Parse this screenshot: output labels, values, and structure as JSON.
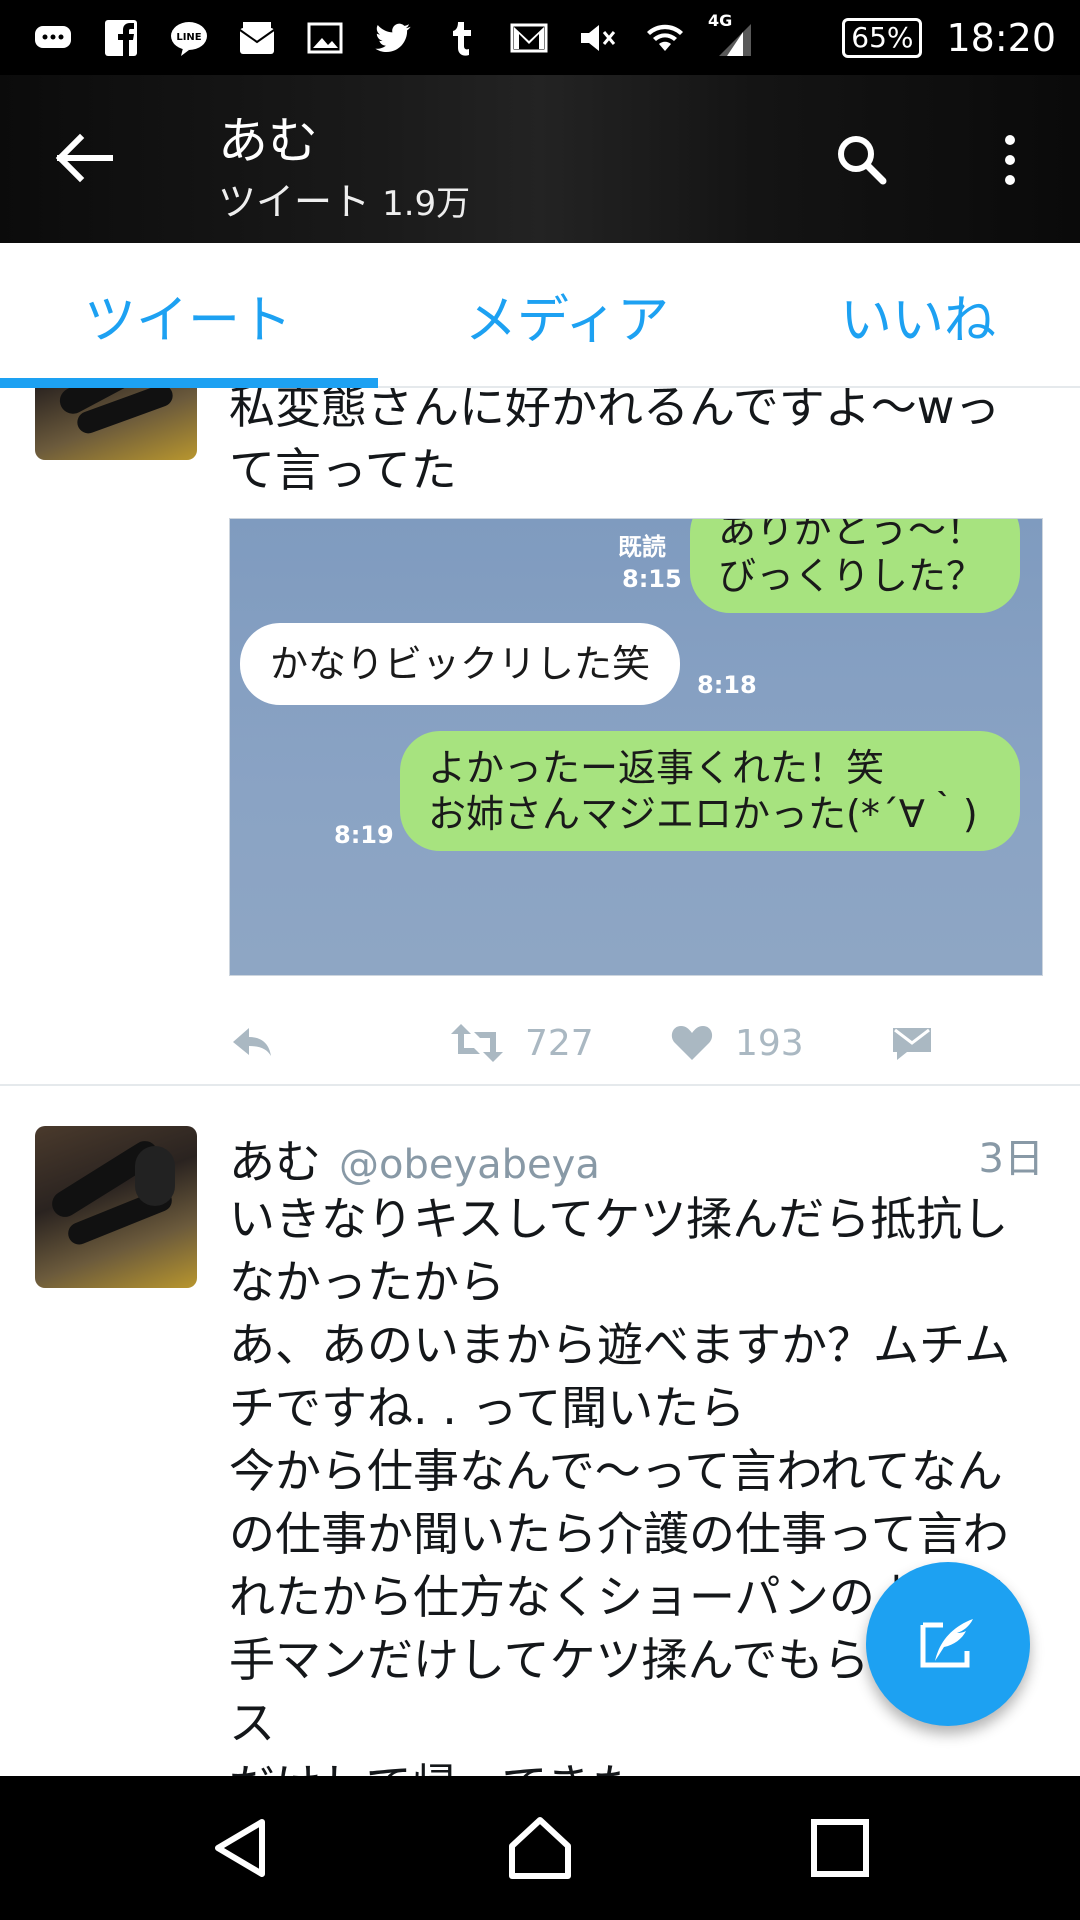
{
  "status_bar": {
    "icons": [
      "chat-bubble-icon",
      "facebook-icon",
      "line-icon",
      "au-mail-icon",
      "gallery-icon",
      "twitter-icon",
      "tumblr-icon",
      "gmail-icon",
      "mute-icon",
      "wifi-icon",
      "signal-4g-icon"
    ],
    "network": "4G",
    "battery": "65%",
    "clock": "18:20"
  },
  "app_bar": {
    "title": "あむ",
    "subtitle_label": "ツイート",
    "subtitle_count": "1.9万"
  },
  "tabs": [
    {
      "label": "ツイート",
      "active": true
    },
    {
      "label": "メディア",
      "active": false
    },
    {
      "label": "いいね",
      "active": false
    }
  ],
  "tweets": [
    {
      "text": "私変態さんに好かれるんですよ〜wっ\nて言ってた",
      "image": {
        "messages": [
          {
            "side": "right",
            "text": "ありがとう〜！\nびっくりした？",
            "read": "既読",
            "time": "8:15"
          },
          {
            "side": "left",
            "text": "かなりビックリした笑",
            "time": "8:18"
          },
          {
            "side": "right",
            "text": "よかったー返事くれた！笑\nお姉さんマジエロかった(*´∀｀)",
            "time": "8:19"
          }
        ]
      },
      "retweets": "727",
      "likes": "193"
    },
    {
      "name": "あむ",
      "handle": "@obeyabeya",
      "time": "3日",
      "text": "いきなりキスしてケツ揉んだら抵抗し\nなかったから\nあ、あのいまから遊べますか？ムチム\nチですね. . って聞いたら\n今から仕事なんで〜って言われてなん\nの仕事か聞いたら介護の仕事って言わ\nれたから仕方なくショーパンの上から\n手マンだけしてケツ揉んでもらってキス\nだけして帰ってきた"
    }
  ],
  "accent_color": "#1da1f2"
}
